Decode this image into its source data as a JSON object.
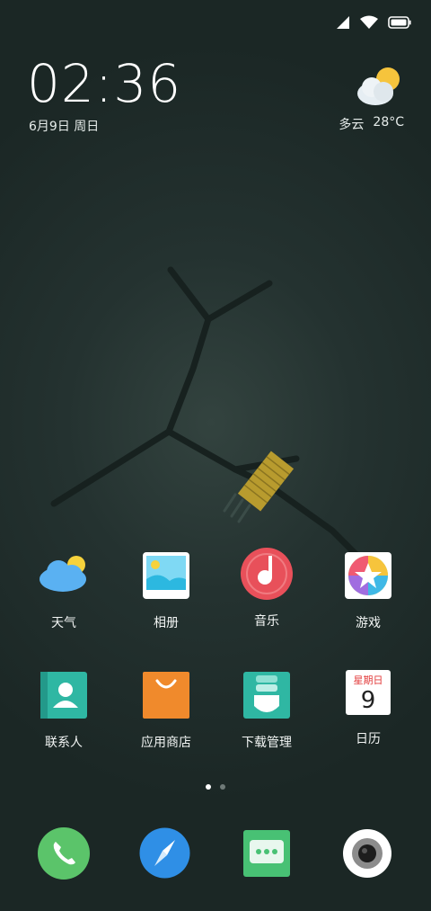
{
  "status_bar": {
    "icons": [
      "signal-icon",
      "wifi-icon",
      "battery-icon"
    ]
  },
  "clock": {
    "time": "02:36",
    "date": "6月9日 周日"
  },
  "weather_widget": {
    "condition": "多云",
    "temperature": "28°C",
    "icon": "partly-cloudy-icon"
  },
  "pager": {
    "pages": 2,
    "current": 1
  },
  "apps": [
    {
      "label": "天气",
      "icon": "weather-app-icon"
    },
    {
      "label": "相册",
      "icon": "gallery-app-icon"
    },
    {
      "label": "音乐",
      "icon": "music-app-icon"
    },
    {
      "label": "游戏",
      "icon": "games-app-icon"
    },
    {
      "label": "联系人",
      "icon": "contacts-app-icon"
    },
    {
      "label": "应用商店",
      "icon": "app-store-icon"
    },
    {
      "label": "下载管理",
      "icon": "download-manager-icon"
    },
    {
      "label": "日历",
      "icon": "calendar-app-icon",
      "badge_top": "星期日",
      "badge_day": "9"
    }
  ],
  "dock": [
    {
      "icon": "phone-icon"
    },
    {
      "icon": "browser-compass-icon"
    },
    {
      "icon": "messages-icon"
    },
    {
      "icon": "camera-icon"
    }
  ],
  "colors": {
    "background": "#1b2725",
    "phone": "#5bc46a",
    "browser": "#2f8fe6",
    "messages": "#48c174",
    "music": "#e8505a",
    "store": "#f08a2c",
    "contacts": "#2fb7a3"
  }
}
